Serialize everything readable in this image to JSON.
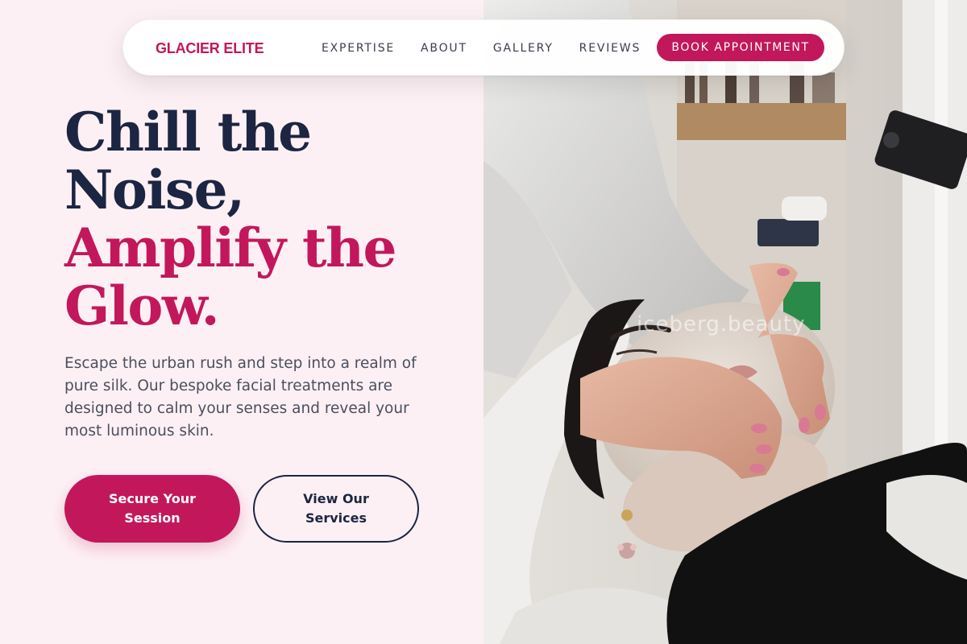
{
  "brand": {
    "name": "GLACIER ELITE"
  },
  "nav": {
    "links": [
      "EXPERTISE",
      "ABOUT",
      "GALLERY",
      "REVIEWS"
    ],
    "cta_label": "BOOK APPOINTMENT"
  },
  "hero": {
    "headline": {
      "line1": "Chill the",
      "line2": "Noise,",
      "line3": "Amplify the",
      "line4": "Glow."
    },
    "lead": "Escape the urban rush and step into a realm of pure silk. Our bespoke facial treatments are designed to calm your senses and reveal your most luminous skin.",
    "primary_button": "Secure Your Session",
    "secondary_button": "View Our Services"
  },
  "photo": {
    "watermark": "iceberg.beauty"
  },
  "colors": {
    "accent": "#c2185b",
    "navy": "#1c2541",
    "background": "#fdf0f4",
    "body_text": "#4a4f5e"
  }
}
